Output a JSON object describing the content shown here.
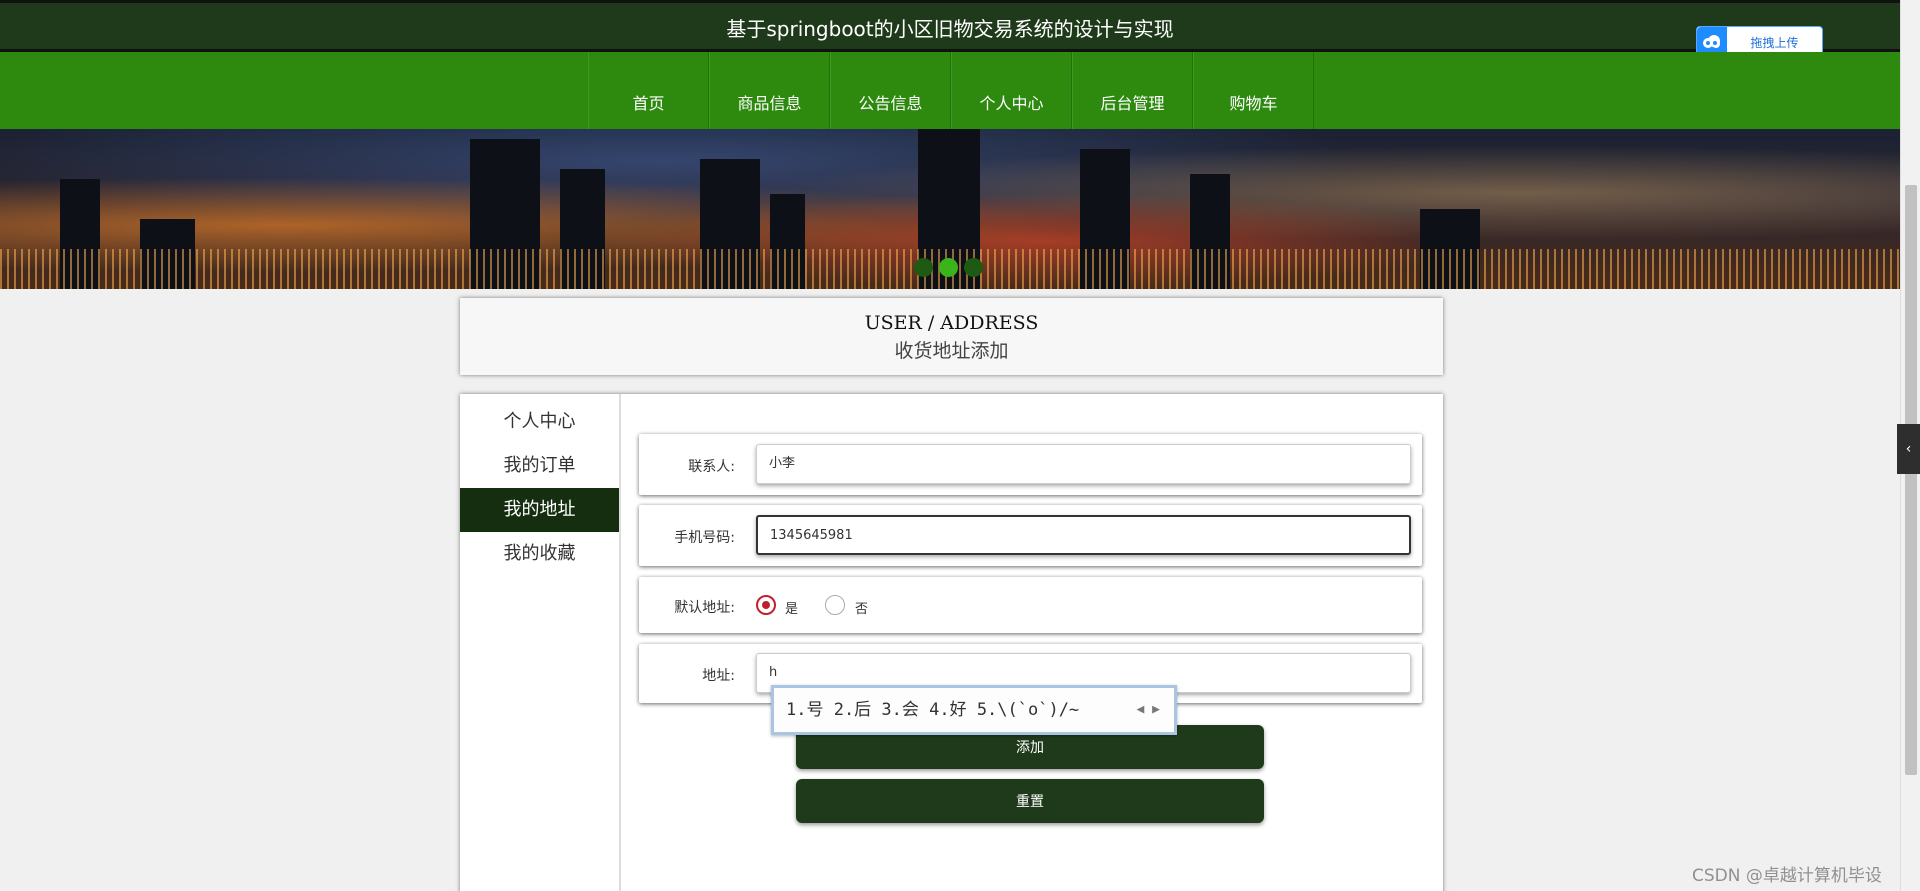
{
  "header": {
    "site_title": "基于springboot的小区旧物交易系统的设计与实现",
    "upload_label": "拖拽上传"
  },
  "nav": {
    "items": [
      {
        "label": "首页"
      },
      {
        "label": "商品信息"
      },
      {
        "label": "公告信息"
      },
      {
        "label": "个人中心"
      },
      {
        "label": "后台管理"
      },
      {
        "label": "购物车"
      }
    ]
  },
  "carousel": {
    "slide_count": 3,
    "active_index": 1
  },
  "page_heading": {
    "en": "USER / ADDRESS",
    "cn": "收货地址添加"
  },
  "side_menu": {
    "items": [
      {
        "label": "个人中心",
        "active": false
      },
      {
        "label": "我的订单",
        "active": false
      },
      {
        "label": "我的地址",
        "active": true
      },
      {
        "label": "我的收藏",
        "active": false
      }
    ]
  },
  "form": {
    "contact": {
      "label": "联系人:",
      "value": "小李"
    },
    "phone": {
      "label": "手机号码:",
      "value": "1345645981"
    },
    "default_address": {
      "label": "默认地址:",
      "options": [
        {
          "label": "是",
          "checked": true
        },
        {
          "label": "否",
          "checked": false
        }
      ]
    },
    "address": {
      "label": "地址:",
      "value": "h"
    },
    "submit_label": "添加",
    "reset_label": "重置"
  },
  "ime_popup": {
    "candidates": "1.号 2.后 3.会 4.好 5.\\(`o`)/~"
  },
  "watermark": "CSDN @卓越计算机毕设"
}
